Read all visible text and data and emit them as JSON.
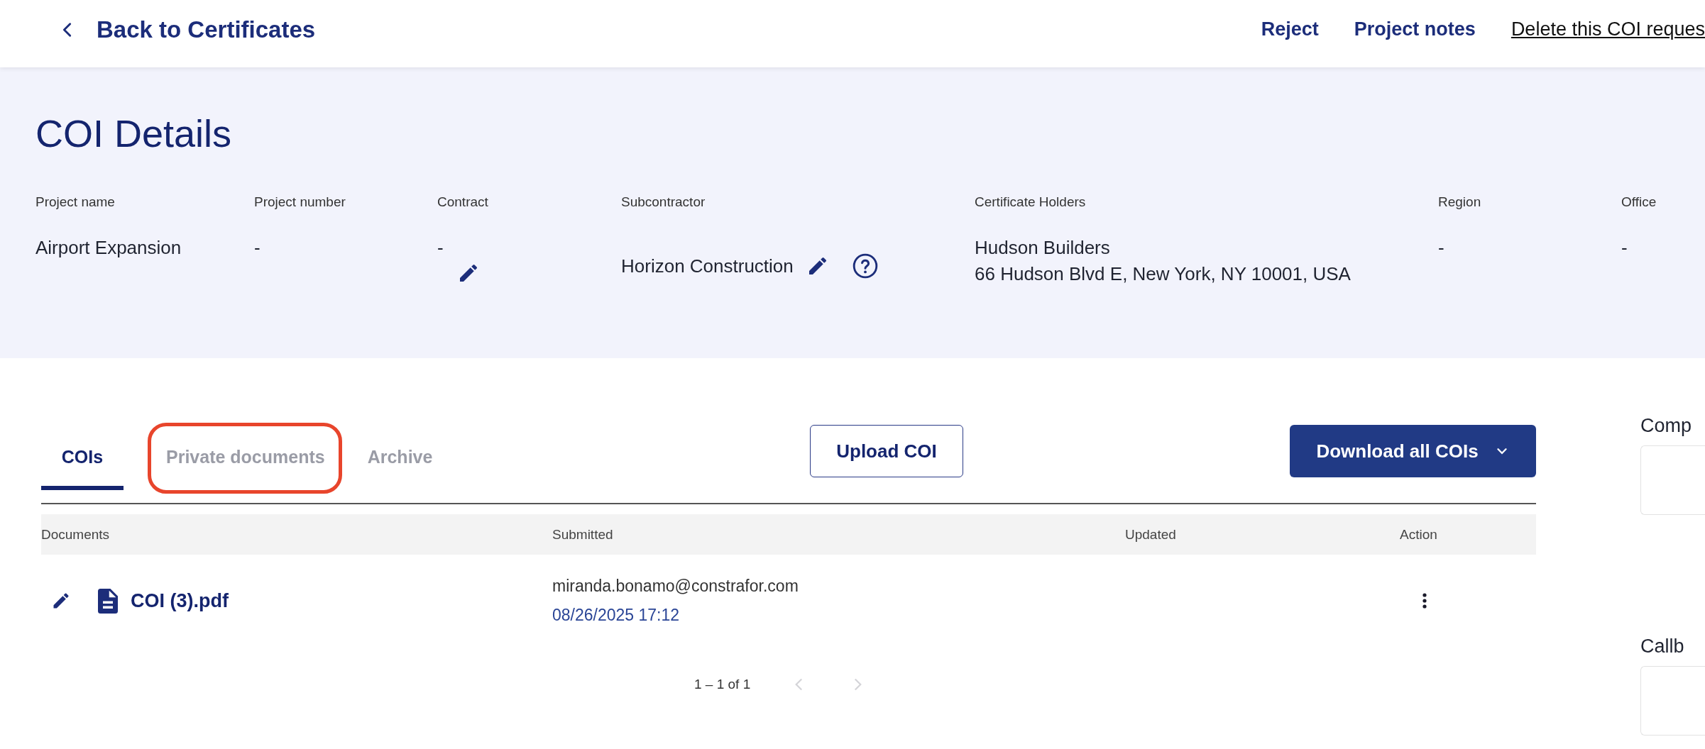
{
  "header": {
    "back_link": "Back to Certificates",
    "actions": [
      "Reject",
      "Project notes"
    ],
    "delete_link": "Delete this COI reques"
  },
  "details": {
    "title": "COI Details",
    "fields": [
      {
        "label": "Project name",
        "value": "Airport Expansion",
        "editable": false,
        "help": false
      },
      {
        "label": "Project number",
        "value": "-",
        "editable": false,
        "help": false
      },
      {
        "label": "Contract",
        "value": "-",
        "editable": true,
        "help": false
      },
      {
        "label": "Subcontractor",
        "value": "Horizon Construction",
        "editable": true,
        "help": true
      },
      {
        "label": "Certificate Holders",
        "value": "Hudson Builders",
        "address": "66 Hudson Blvd E, New York, NY 10001, USA",
        "editable": false,
        "help": false
      },
      {
        "label": "Region",
        "value": "-",
        "editable": false,
        "help": false
      },
      {
        "label": "Office",
        "value": "-",
        "editable": false,
        "help": false
      }
    ]
  },
  "tabs": [
    {
      "label": "COIs",
      "selected": true,
      "highlighted": false
    },
    {
      "label": "Private documents",
      "selected": false,
      "highlighted": true
    },
    {
      "label": "Archive",
      "selected": false,
      "highlighted": false
    }
  ],
  "upload_button": "Upload COI",
  "download_button": "Download all COIs",
  "table": {
    "columns": [
      "Documents",
      "Submitted",
      "Updated",
      "Action"
    ],
    "rows": [
      {
        "document": "COI (3).pdf",
        "submitted_by": "miranda.bonamo@constrafor.com",
        "submitted_at": "08/26/2025 17:12"
      }
    ]
  },
  "pagination": {
    "range": "1 – 1 of 1"
  },
  "side_panel": {
    "fields": [
      {
        "label": "Comp"
      },
      {
        "label": "Callb"
      }
    ]
  }
}
